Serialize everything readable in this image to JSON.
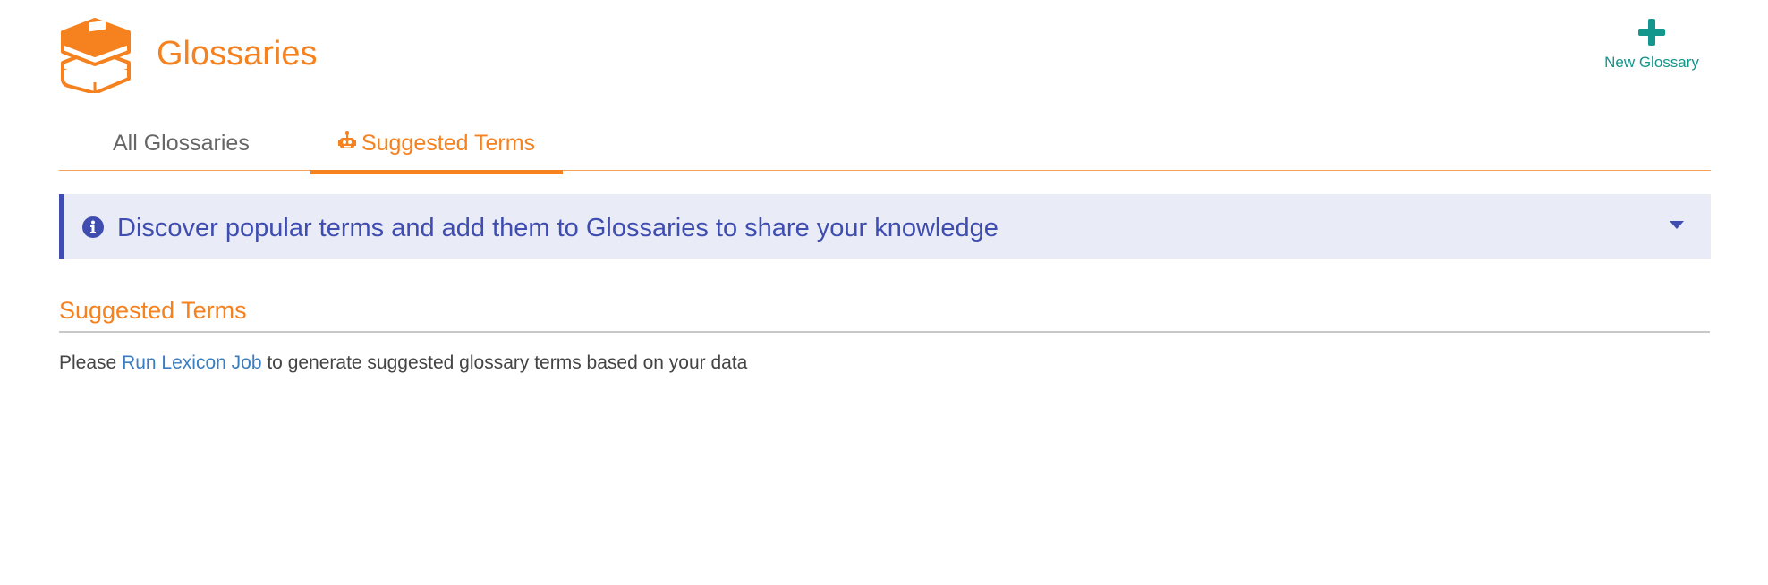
{
  "header": {
    "title": "Glossaries",
    "logo_icon": "books-stack-icon",
    "new_glossary_label": "New Glossary",
    "new_glossary_icon": "plus-icon"
  },
  "tabs": [
    {
      "label": "All Glossaries",
      "active": false
    },
    {
      "label": "Suggested Terms",
      "active": true,
      "icon": "robot-icon"
    }
  ],
  "info_banner": {
    "icon": "info-circle-icon",
    "text": "Discover popular terms and add them to Glossaries to share your knowledge",
    "toggle_icon": "caret-down-icon"
  },
  "section": {
    "title": "Suggested Terms",
    "message_prefix": "Please",
    "message_link": "Run Lexicon Job",
    "message_suffix": "to generate suggested glossary terms based on your data"
  },
  "colors": {
    "accent_orange": "#f5811f",
    "teal": "#13968c",
    "info_blue": "#3f4db1",
    "info_bg": "#e9ecf6",
    "link_blue": "#3a7dc0"
  }
}
